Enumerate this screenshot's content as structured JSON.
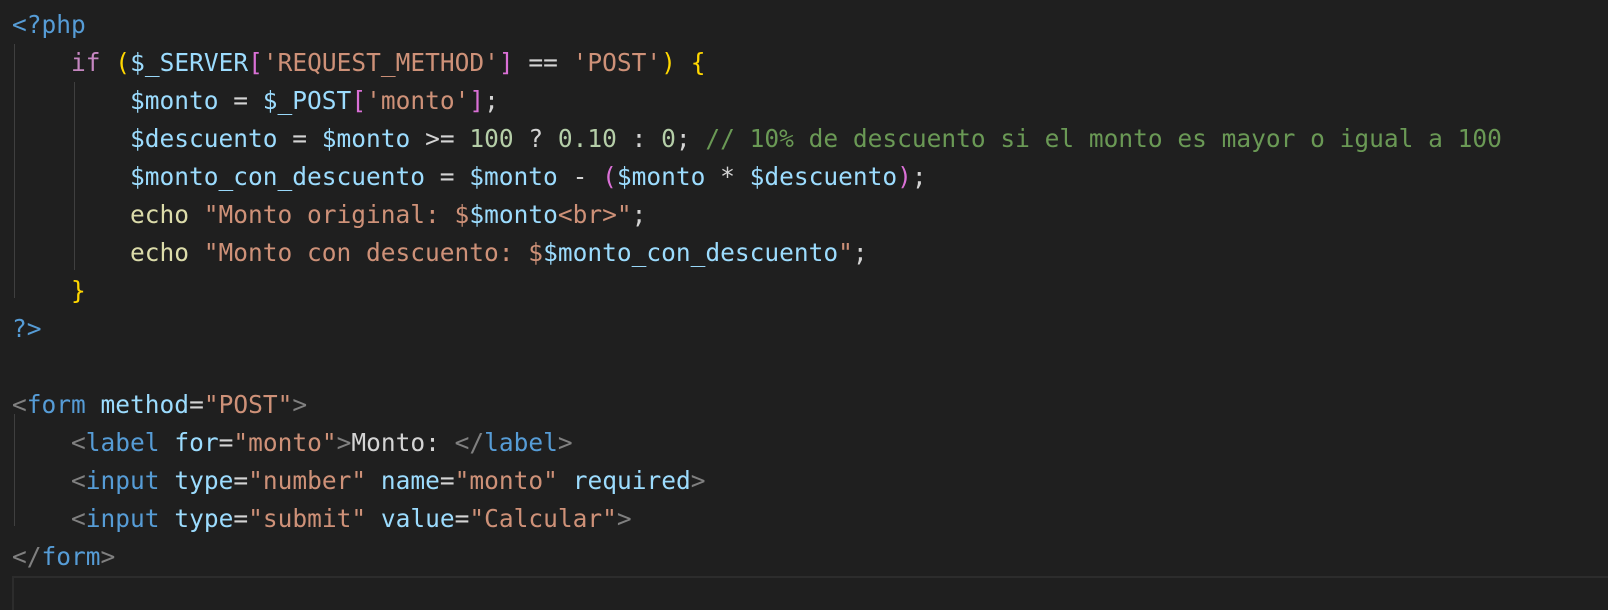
{
  "editor": {
    "language": "php",
    "colors": {
      "background": "#1f1f1f",
      "keyword": "#c586c0",
      "variable": "#9cdcfe",
      "string": "#ce9178",
      "number": "#b5cea8",
      "comment": "#6a9955",
      "function": "#dcdcaa",
      "tag": "#569cd6",
      "bracket_1": "#ffd700",
      "bracket_2": "#da70d6"
    },
    "lines": [
      {
        "tokens": [
          {
            "c": "t-php",
            "t": "<?php"
          }
        ]
      },
      {
        "tokens": [
          {
            "c": "t-txt",
            "t": "    "
          },
          {
            "c": "t-kw",
            "t": "if"
          },
          {
            "c": "t-txt",
            "t": " "
          },
          {
            "c": "t-br1",
            "t": "("
          },
          {
            "c": "t-var",
            "t": "$_SERVER"
          },
          {
            "c": "t-br2",
            "t": "["
          },
          {
            "c": "t-str",
            "t": "'REQUEST_METHOD'"
          },
          {
            "c": "t-br2",
            "t": "]"
          },
          {
            "c": "t-op",
            "t": " == "
          },
          {
            "c": "t-str",
            "t": "'POST'"
          },
          {
            "c": "t-br1",
            "t": ")"
          },
          {
            "c": "t-txt",
            "t": " "
          },
          {
            "c": "t-br1",
            "t": "{"
          }
        ]
      },
      {
        "tokens": [
          {
            "c": "t-txt",
            "t": "        "
          },
          {
            "c": "t-var",
            "t": "$monto"
          },
          {
            "c": "t-op",
            "t": " = "
          },
          {
            "c": "t-var",
            "t": "$_POST"
          },
          {
            "c": "t-br2",
            "t": "["
          },
          {
            "c": "t-str",
            "t": "'monto'"
          },
          {
            "c": "t-br2",
            "t": "]"
          },
          {
            "c": "t-op",
            "t": ";"
          }
        ]
      },
      {
        "tokens": [
          {
            "c": "t-txt",
            "t": "        "
          },
          {
            "c": "t-var",
            "t": "$descuento"
          },
          {
            "c": "t-op",
            "t": " = "
          },
          {
            "c": "t-var",
            "t": "$monto"
          },
          {
            "c": "t-op",
            "t": " >= "
          },
          {
            "c": "t-num",
            "t": "100"
          },
          {
            "c": "t-op",
            "t": " ? "
          },
          {
            "c": "t-num",
            "t": "0.10"
          },
          {
            "c": "t-op",
            "t": " : "
          },
          {
            "c": "t-num",
            "t": "0"
          },
          {
            "c": "t-op",
            "t": "; "
          },
          {
            "c": "t-cmt",
            "t": "// 10% de descuento si el monto es mayor o igual a 100"
          }
        ]
      },
      {
        "tokens": [
          {
            "c": "t-txt",
            "t": "        "
          },
          {
            "c": "t-var",
            "t": "$monto_con_descuento"
          },
          {
            "c": "t-op",
            "t": " = "
          },
          {
            "c": "t-var",
            "t": "$monto"
          },
          {
            "c": "t-op",
            "t": " - "
          },
          {
            "c": "t-br2",
            "t": "("
          },
          {
            "c": "t-var",
            "t": "$monto"
          },
          {
            "c": "t-op",
            "t": " * "
          },
          {
            "c": "t-var",
            "t": "$descuento"
          },
          {
            "c": "t-br2",
            "t": ")"
          },
          {
            "c": "t-op",
            "t": ";"
          }
        ]
      },
      {
        "tokens": [
          {
            "c": "t-txt",
            "t": "        "
          },
          {
            "c": "t-fn",
            "t": "echo"
          },
          {
            "c": "t-txt",
            "t": " "
          },
          {
            "c": "t-str",
            "t": "\"Monto original: $"
          },
          {
            "c": "t-var",
            "t": "$monto"
          },
          {
            "c": "t-str",
            "t": "<br>\""
          },
          {
            "c": "t-op",
            "t": ";"
          }
        ]
      },
      {
        "tokens": [
          {
            "c": "t-txt",
            "t": "        "
          },
          {
            "c": "t-fn",
            "t": "echo"
          },
          {
            "c": "t-txt",
            "t": " "
          },
          {
            "c": "t-str",
            "t": "\"Monto con descuento: $"
          },
          {
            "c": "t-var",
            "t": "$monto_con_descuento"
          },
          {
            "c": "t-str",
            "t": "\""
          },
          {
            "c": "t-op",
            "t": ";"
          }
        ]
      },
      {
        "tokens": [
          {
            "c": "t-txt",
            "t": "    "
          },
          {
            "c": "t-br1",
            "t": "}"
          }
        ]
      },
      {
        "tokens": [
          {
            "c": "t-php",
            "t": "?>"
          }
        ]
      },
      {
        "tokens": []
      },
      {
        "tokens": [
          {
            "c": "t-punc",
            "t": "<"
          },
          {
            "c": "t-tag",
            "t": "form"
          },
          {
            "c": "t-txt",
            "t": " "
          },
          {
            "c": "t-attr",
            "t": "method"
          },
          {
            "c": "t-op",
            "t": "="
          },
          {
            "c": "t-str",
            "t": "\"POST\""
          },
          {
            "c": "t-punc",
            "t": ">"
          }
        ]
      },
      {
        "tokens": [
          {
            "c": "t-txt",
            "t": "    "
          },
          {
            "c": "t-punc",
            "t": "<"
          },
          {
            "c": "t-tag",
            "t": "label"
          },
          {
            "c": "t-txt",
            "t": " "
          },
          {
            "c": "t-attr",
            "t": "for"
          },
          {
            "c": "t-op",
            "t": "="
          },
          {
            "c": "t-str",
            "t": "\"monto\""
          },
          {
            "c": "t-punc",
            "t": ">"
          },
          {
            "c": "t-txt",
            "t": "Monto: "
          },
          {
            "c": "t-punc",
            "t": "</"
          },
          {
            "c": "t-tag",
            "t": "label"
          },
          {
            "c": "t-punc",
            "t": ">"
          }
        ]
      },
      {
        "tokens": [
          {
            "c": "t-txt",
            "t": "    "
          },
          {
            "c": "t-punc",
            "t": "<"
          },
          {
            "c": "t-tag",
            "t": "input"
          },
          {
            "c": "t-txt",
            "t": " "
          },
          {
            "c": "t-attr",
            "t": "type"
          },
          {
            "c": "t-op",
            "t": "="
          },
          {
            "c": "t-str",
            "t": "\"number\""
          },
          {
            "c": "t-txt",
            "t": " "
          },
          {
            "c": "t-attr",
            "t": "name"
          },
          {
            "c": "t-op",
            "t": "="
          },
          {
            "c": "t-str",
            "t": "\"monto\""
          },
          {
            "c": "t-txt",
            "t": " "
          },
          {
            "c": "t-attr",
            "t": "required"
          },
          {
            "c": "t-punc",
            "t": ">"
          }
        ]
      },
      {
        "tokens": [
          {
            "c": "t-txt",
            "t": "    "
          },
          {
            "c": "t-punc",
            "t": "<"
          },
          {
            "c": "t-tag",
            "t": "input"
          },
          {
            "c": "t-txt",
            "t": " "
          },
          {
            "c": "t-attr",
            "t": "type"
          },
          {
            "c": "t-op",
            "t": "="
          },
          {
            "c": "t-str",
            "t": "\"submit\""
          },
          {
            "c": "t-txt",
            "t": " "
          },
          {
            "c": "t-attr",
            "t": "value"
          },
          {
            "c": "t-op",
            "t": "="
          },
          {
            "c": "t-str",
            "t": "\"Calcular\""
          },
          {
            "c": "t-punc",
            "t": ">"
          }
        ]
      },
      {
        "tokens": [
          {
            "c": "t-punc",
            "t": "</"
          },
          {
            "c": "t-tag",
            "t": "form"
          },
          {
            "c": "t-punc",
            "t": ">"
          }
        ]
      },
      {
        "tokens": []
      }
    ]
  }
}
